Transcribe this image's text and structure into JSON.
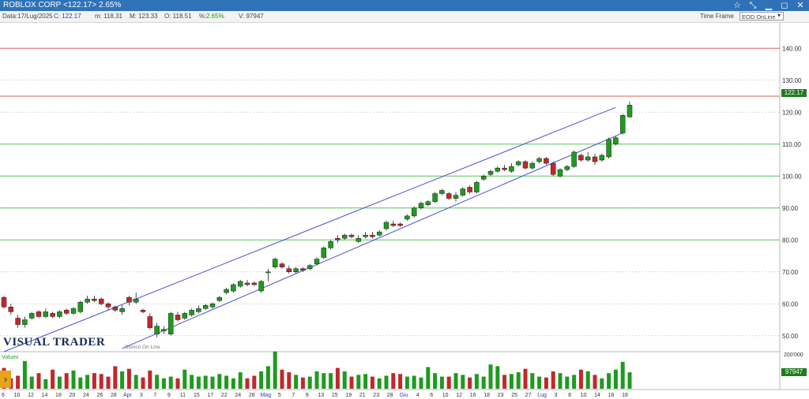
{
  "window": {
    "title": "ROBLOX CORP <122.17> 2.65%"
  },
  "info": {
    "date": "Data:17/Lug/2025",
    "close": "C: 122.17",
    "min": "m: 118.31",
    "max": "M: 123.33",
    "open": "O: 118.51",
    "pct_label": "%:",
    "pct": "2.65%",
    "volume": "V: 97947",
    "timeframe_label": "Time Frame",
    "feed": "EOD OnLine",
    "feed_arrow": "▾"
  },
  "icons": {
    "star": "star-icon",
    "tools": "tools-icon",
    "minimize": "minimize-icon",
    "maximize": "maximize-icon",
    "close": "close-icon",
    "nav": "arrow-right-icon"
  },
  "branding": {
    "logo": "VISUAL TRADER",
    "storico": "Storico On Line"
  },
  "badges": {
    "last_price": "122.17",
    "last_volume": "97947",
    "volume_top": "200'000"
  },
  "volume_panel": {
    "label": "Volumi"
  },
  "colors": {
    "up": "#1f9a1f",
    "down": "#c0282b",
    "channel": "#4a4fd0",
    "green_level": "#5cc85c",
    "red_level": "#e06060"
  },
  "chart_data": {
    "type": "candlestick",
    "y_ticks": [
      "50.00",
      "60.00",
      "70.00",
      "80.00",
      "90.00",
      "100.00",
      "110.00",
      "120.00",
      "130.00",
      "140.00"
    ],
    "ylim": [
      45,
      145
    ],
    "horizontal_lines": [
      {
        "value": 140,
        "color": "red"
      },
      {
        "value": 125,
        "color": "red"
      },
      {
        "value": 110,
        "color": "green"
      },
      {
        "value": 100,
        "color": "green"
      },
      {
        "value": 90,
        "color": "green"
      },
      {
        "value": 80,
        "color": "green"
      }
    ],
    "channel": [
      {
        "from": [
          0,
          45
        ],
        "to": [
          88,
          121.5
        ]
      },
      {
        "from": [
          17,
          46
        ],
        "to": [
          89,
          113.5
        ]
      }
    ],
    "x_labels": [
      "6",
      "10",
      "12",
      "14",
      "18",
      "20",
      "24",
      "26",
      "28",
      "Apr",
      "3",
      "7",
      "9",
      "11",
      "15",
      "17",
      "22",
      "24",
      "28",
      "Mag",
      "5",
      "7",
      "9",
      "13",
      "15",
      "19",
      "21",
      "23",
      "28",
      "Giu",
      "4",
      "6",
      "10",
      "12",
      "16",
      "18",
      "23",
      "25",
      "27",
      "Lug",
      "3",
      "8",
      "10",
      "14",
      "16",
      "18"
    ],
    "x_label_highlight": [
      "Apr",
      "Mag",
      "Giu",
      "Lug"
    ],
    "candles": [
      [
        0,
        62.0,
        59.0,
        62.5,
        58.5
      ],
      [
        1,
        59.0,
        57.5,
        60.0,
        56.5
      ],
      [
        2,
        55.5,
        53.5,
        56.5,
        52.5
      ],
      [
        3,
        53.5,
        55.0,
        56.0,
        52.5
      ],
      [
        4,
        55.5,
        57.0,
        57.5,
        55.0
      ],
      [
        5,
        57.5,
        56.0,
        58.0,
        55.5
      ],
      [
        6,
        56.0,
        57.5,
        58.5,
        55.5
      ],
      [
        7,
        57.0,
        56.0,
        57.5,
        55.5
      ],
      [
        8,
        56.0,
        57.5,
        58.0,
        55.5
      ],
      [
        9,
        58.0,
        57.0,
        58.5,
        56.5
      ],
      [
        10,
        57.0,
        58.5,
        59.0,
        56.5
      ],
      [
        11,
        57.5,
        60.5,
        61.0,
        57.0
      ],
      [
        12,
        60.5,
        61.5,
        62.5,
        60.0
      ],
      [
        13,
        61.5,
        61.0,
        62.5,
        60.5
      ],
      [
        14,
        61.5,
        60.0,
        62.0,
        59.5
      ],
      [
        15,
        60.0,
        59.0,
        60.5,
        58.0
      ],
      [
        16,
        59.0,
        58.0,
        59.5,
        57.5
      ],
      [
        17,
        57.5,
        58.5,
        59.5,
        56.5
      ],
      [
        18,
        62.0,
        60.5,
        62.5,
        59.5
      ],
      [
        19,
        60.5,
        61.5,
        63.5,
        60.0
      ],
      [
        20,
        58.0,
        57.5,
        58.5,
        57.0
      ],
      [
        21,
        56.0,
        52.5,
        57.0,
        52.0
      ],
      [
        22,
        50.5,
        53.0,
        54.0,
        49.5
      ],
      [
        23,
        51.5,
        52.0,
        53.0,
        50.5
      ],
      [
        24,
        50.5,
        57.0,
        57.5,
        50.0
      ],
      [
        25,
        56.5,
        55.0,
        57.5,
        54.5
      ],
      [
        26,
        55.5,
        57.0,
        57.5,
        55.0
      ],
      [
        27,
        56.5,
        58.0,
        58.5,
        56.0
      ],
      [
        28,
        57.5,
        58.5,
        59.5,
        57.0
      ],
      [
        29,
        58.5,
        59.5,
        60.0,
        58.0
      ],
      [
        30,
        59.0,
        60.0,
        60.5,
        58.5
      ],
      [
        31,
        61.0,
        62.0,
        62.5,
        60.5
      ],
      [
        32,
        63.5,
        64.5,
        65.0,
        63.0
      ],
      [
        33,
        64.0,
        66.0,
        66.5,
        63.5
      ],
      [
        34,
        65.5,
        67.0,
        67.5,
        65.0
      ],
      [
        35,
        66.5,
        66.0,
        67.5,
        65.5
      ],
      [
        36,
        66.5,
        66.0,
        67.0,
        65.5
      ],
      [
        37,
        64.0,
        67.0,
        67.5,
        63.5
      ],
      [
        38,
        70.0,
        70.0,
        71.0,
        67.0
      ],
      [
        39,
        71.5,
        74.0,
        74.5,
        71.0
      ],
      [
        40,
        72.5,
        71.5,
        73.0,
        71.0
      ],
      [
        41,
        71.0,
        70.0,
        72.0,
        69.5
      ],
      [
        42,
        70.0,
        71.0,
        71.5,
        69.5
      ],
      [
        43,
        71.0,
        70.5,
        71.5,
        70.0
      ],
      [
        44,
        71.0,
        72.0,
        72.5,
        70.5
      ],
      [
        45,
        72.5,
        74.0,
        74.5,
        72.0
      ],
      [
        46,
        74.5,
        77.5,
        78.0,
        74.0
      ],
      [
        47,
        77.5,
        79.5,
        80.0,
        77.0
      ],
      [
        48,
        80.5,
        80.0,
        81.5,
        79.0
      ],
      [
        49,
        80.5,
        81.5,
        82.0,
        80.0
      ],
      [
        50,
        81.5,
        81.0,
        82.0,
        80.5
      ],
      [
        51,
        79.5,
        80.5,
        81.5,
        79.0
      ],
      [
        52,
        81.0,
        81.5,
        82.5,
        80.5
      ],
      [
        53,
        81.5,
        81.0,
        82.5,
        80.5
      ],
      [
        54,
        81.5,
        82.5,
        83.0,
        81.0
      ],
      [
        55,
        83.5,
        85.5,
        86.0,
        83.0
      ],
      [
        56,
        85.0,
        84.5,
        86.0,
        84.0
      ],
      [
        57,
        85.0,
        84.5,
        85.5,
        84.0
      ],
      [
        58,
        86.5,
        87.5,
        88.0,
        86.0
      ],
      [
        59,
        87.5,
        90.0,
        90.5,
        87.0
      ],
      [
        60,
        90.0,
        91.5,
        92.0,
        89.5
      ],
      [
        61,
        91.0,
        92.0,
        92.5,
        90.5
      ],
      [
        62,
        92.0,
        94.5,
        95.0,
        91.5
      ],
      [
        63,
        94.5,
        95.5,
        96.0,
        94.0
      ],
      [
        64,
        94.5,
        93.0,
        95.0,
        92.5
      ],
      [
        65,
        93.0,
        94.0,
        95.0,
        92.0
      ],
      [
        66,
        94.0,
        96.0,
        96.5,
        93.5
      ],
      [
        67,
        96.5,
        95.0,
        97.0,
        94.5
      ],
      [
        68,
        95.0,
        98.0,
        98.5,
        94.5
      ],
      [
        69,
        99.0,
        100.0,
        100.5,
        98.5
      ],
      [
        70,
        100.5,
        101.5,
        102.0,
        100.0
      ],
      [
        71,
        101.5,
        102.5,
        103.0,
        101.0
      ],
      [
        72,
        102.5,
        102.0,
        103.5,
        101.5
      ],
      [
        73,
        101.5,
        103.0,
        104.0,
        101.0
      ],
      [
        74,
        103.5,
        104.5,
        105.0,
        103.0
      ],
      [
        75,
        104.5,
        102.5,
        105.0,
        102.0
      ],
      [
        76,
        102.5,
        104.0,
        104.5,
        102.0
      ],
      [
        77,
        104.5,
        105.5,
        106.0,
        104.0
      ],
      [
        78,
        105.5,
        104.0,
        106.0,
        103.5
      ],
      [
        79,
        104.0,
        100.5,
        104.5,
        100.0
      ],
      [
        80,
        100.0,
        102.0,
        102.5,
        99.5
      ],
      [
        81,
        102.0,
        103.0,
        103.5,
        101.5
      ],
      [
        82,
        103.0,
        107.5,
        108.0,
        102.5
      ],
      [
        83,
        106.5,
        105.0,
        107.0,
        104.5
      ],
      [
        84,
        105.0,
        106.0,
        107.5,
        104.5
      ],
      [
        85,
        106.0,
        104.5,
        107.0,
        103.5
      ],
      [
        86,
        105.0,
        106.5,
        107.0,
        104.5
      ],
      [
        87,
        106.0,
        111.5,
        112.0,
        105.5
      ],
      [
        88,
        110.0,
        112.0,
        112.5,
        109.5
      ],
      [
        89,
        113.5,
        119.0,
        119.5,
        113.0
      ],
      [
        90,
        118.5,
        122.2,
        123.3,
        118.3
      ]
    ],
    "volumes": [
      120,
      60,
      75,
      160,
      70,
      90,
      55,
      110,
      70,
      90,
      105,
      65,
      80,
      90,
      85,
      70,
      130,
      100,
      115,
      80,
      65,
      105,
      80,
      60,
      70,
      60,
      110,
      80,
      70,
      75,
      70,
      85,
      75,
      60,
      95,
      60,
      75,
      100,
      130,
      215,
      110,
      95,
      80,
      65,
      70,
      100,
      90,
      90,
      120,
      100,
      70,
      80,
      85,
      70,
      60,
      75,
      90,
      85,
      70,
      75,
      65,
      125,
      90,
      70,
      70,
      90,
      80,
      65,
      85,
      70,
      140,
      130,
      80,
      85,
      95,
      115,
      90,
      70,
      65,
      100,
      90,
      70,
      80,
      110,
      100,
      80,
      60,
      90,
      110,
      155,
      95
    ],
    "volume_ylim": [
      0,
      200
    ]
  }
}
